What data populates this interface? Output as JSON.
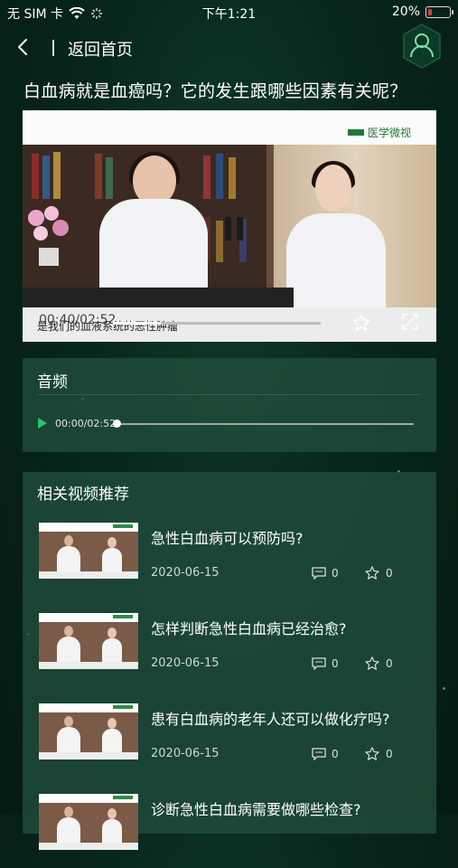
{
  "status_bar": {
    "carrier": "无 SIM 卡",
    "time": "下午1:21",
    "battery_text": "20%",
    "battery_level": 0.2,
    "battery_color": "#e53935"
  },
  "nav": {
    "back_icon": "chevron-left-icon",
    "title": "返回首页",
    "profile_icon": "user-icon"
  },
  "headline": "白血病就是血癌吗？它的发生跟哪些因素有关呢？",
  "video": {
    "brand": "医学微视",
    "current_time": "00:40/02:52",
    "subtitle": "是我们的血液系统的恶性肿瘤",
    "progress": 0.23,
    "state": "paused"
  },
  "audio": {
    "title": "音频",
    "time": "00:00/02:52",
    "progress": 0.0
  },
  "related": {
    "title": "相关视频推荐",
    "items": [
      {
        "title": "急性白血病可以预防吗?",
        "date": "2020-06-15",
        "comments": "0",
        "stars": "0"
      },
      {
        "title": "怎样判断急性白血病已经治愈?",
        "date": "2020-06-15",
        "comments": "0",
        "stars": "0"
      },
      {
        "title": "患有白血病的老年人还可以做化疗吗?",
        "date": "2020-06-15",
        "comments": "0",
        "stars": "0"
      },
      {
        "title": "诊断急性白血病需要做哪些检查?",
        "date": "",
        "comments": "",
        "stars": ""
      }
    ]
  },
  "colors": {
    "accent": "#2e8b47",
    "panel": "#21503e",
    "background": "#08271c"
  }
}
